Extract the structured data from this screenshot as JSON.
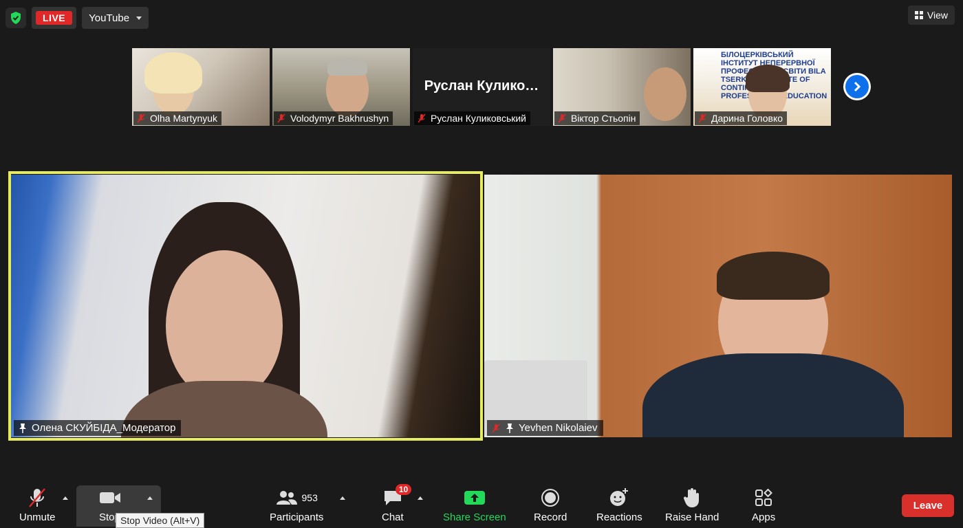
{
  "top_bar": {
    "live_label": "LIVE",
    "stream_target": "YouTube",
    "view_label": "View"
  },
  "thumbnails": [
    {
      "name": "Olha Martynyuk",
      "muted": true
    },
    {
      "name": "Volodymyr Bakhrushyn",
      "muted": true
    },
    {
      "name": "Руслан Куликовський",
      "muted": true,
      "display_name": "Руслан  Кулико…"
    },
    {
      "name": "Віктор Стьопін",
      "muted": true
    },
    {
      "name": "Дарина Головко",
      "muted": true,
      "banner_text": "БІЛОЦЕРКІВСЬКИЙ ІНСТИТУТ НЕПЕРЕРВНОЇ ПРОФЕСІЙНОЇ ОСВІТИ BILA TSERKVA INSTITUTE OF CONTINUOUS PROFESSIONAL EDUCATION"
    }
  ],
  "main_videos": [
    {
      "name": "Олена СКУЙБІДА_Модератор",
      "pinned": true,
      "active_speaker": true
    },
    {
      "name": "Yevhen Nikolaiev",
      "pinned": true,
      "muted": true
    }
  ],
  "toolbar": {
    "unmute_label": "Unmute",
    "stop_video_label": "Stop Video",
    "participants_label": "Participants",
    "participants_count": "953",
    "chat_label": "Chat",
    "chat_badge": "10",
    "share_label": "Share Screen",
    "record_label": "Record",
    "reactions_label": "Reactions",
    "raise_hand_label": "Raise Hand",
    "apps_label": "Apps",
    "leave_label": "Leave",
    "tooltip": "Stop Video (Alt+V)"
  },
  "colors": {
    "live_red": "#e02828",
    "active_speaker_border": "#e7ec5c",
    "share_green": "#23d959",
    "leave_red": "#d9302b",
    "next_blue": "#0e71eb"
  }
}
